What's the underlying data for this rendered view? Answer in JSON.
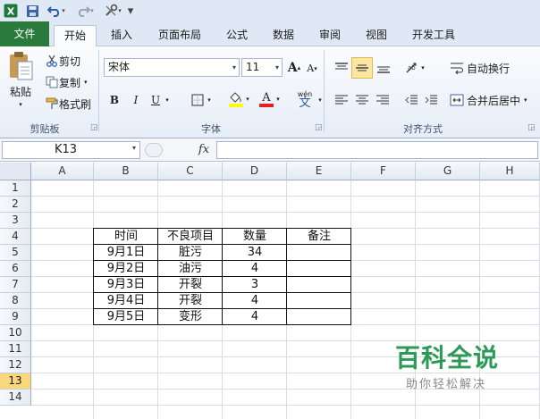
{
  "qat": {
    "customize_arrow": "▾"
  },
  "tabs": [
    {
      "label": "文件"
    },
    {
      "label": "开始"
    },
    {
      "label": "插入"
    },
    {
      "label": "页面布局"
    },
    {
      "label": "公式"
    },
    {
      "label": "数据"
    },
    {
      "label": "审阅"
    },
    {
      "label": "视图"
    },
    {
      "label": "开发工具"
    }
  ],
  "ribbon": {
    "clipboard": {
      "paste": "粘贴",
      "cut": "剪切",
      "copy": "复制",
      "format_painter": "格式刷",
      "group": "剪贴板"
    },
    "font": {
      "name": "宋体",
      "size": "11",
      "grow": "A",
      "shrink": "A",
      "bold": "B",
      "italic": "I",
      "underline": "U",
      "phonetic": "wén",
      "phonetic_char": "文",
      "group": "字体"
    },
    "align": {
      "wrap": "自动换行",
      "merge": "合并后居中",
      "group": "对齐方式"
    }
  },
  "formula_bar": {
    "name_box": "K13",
    "fx": "fx",
    "value": ""
  },
  "columns": [
    "A",
    "B",
    "C",
    "D",
    "E",
    "F",
    "G",
    "H"
  ],
  "rows": [
    "1",
    "2",
    "3",
    "4",
    "5",
    "6",
    "7",
    "8",
    "9",
    "10",
    "11",
    "12",
    "13",
    "14"
  ],
  "selected_row": "13",
  "table": {
    "headers": [
      "时间",
      "不良项目",
      "数量",
      "备注"
    ],
    "rows": [
      [
        "9月1日",
        "脏污",
        "34",
        ""
      ],
      [
        "9月2日",
        "油污",
        "4",
        ""
      ],
      [
        "9月3日",
        "开裂",
        "3",
        ""
      ],
      [
        "9月4日",
        "开裂",
        "4",
        ""
      ],
      [
        "9月5日",
        "变形",
        "4",
        ""
      ]
    ]
  },
  "watermark": {
    "title": "百科全说",
    "subtitle": "助你轻松解决"
  },
  "colors": {
    "file_tab": "#2a7a3c",
    "selected_row": "#f9d77b",
    "watermark_green": "#2c9a57"
  }
}
